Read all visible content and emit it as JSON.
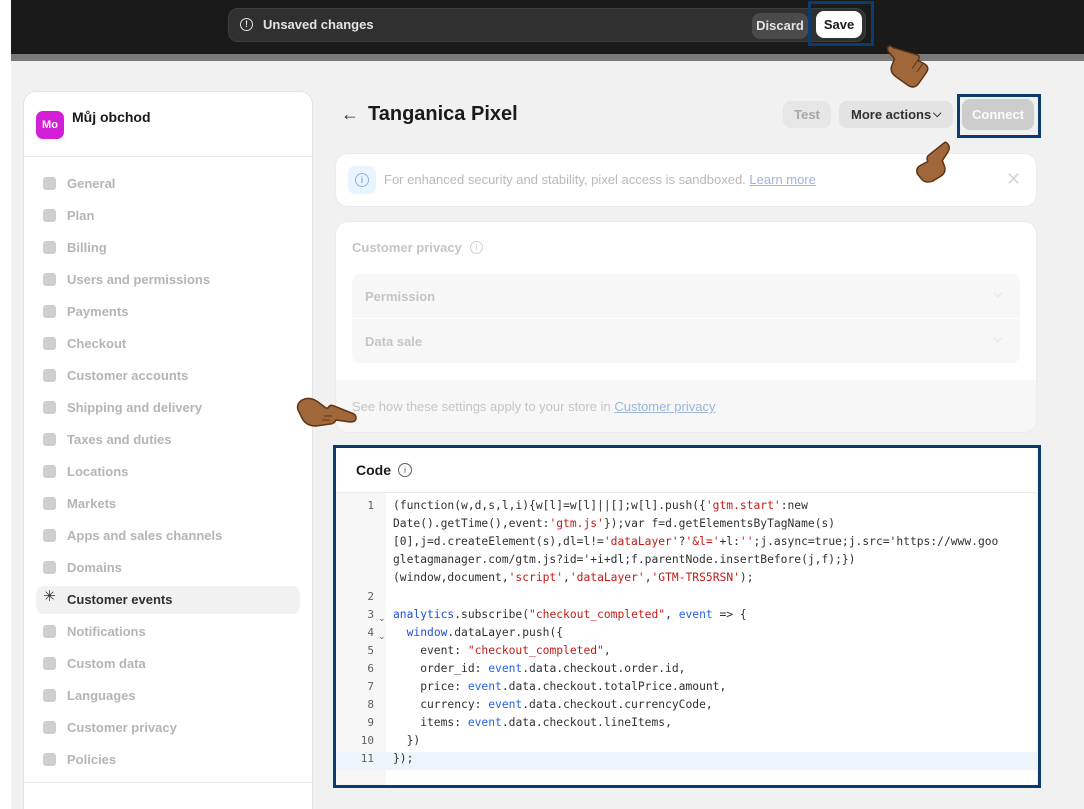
{
  "topbar": {
    "unsaved_label": "Unsaved changes",
    "discard_label": "Discard",
    "save_label": "Save"
  },
  "store": {
    "avatar_initials": "Mo",
    "name": "Můj obchod",
    "avatar_color": "#d31fd7"
  },
  "sidebar": {
    "items": [
      {
        "label": "General",
        "icon": "store-icon"
      },
      {
        "label": "Plan",
        "icon": "chart-icon"
      },
      {
        "label": "Billing",
        "icon": "billing-icon"
      },
      {
        "label": "Users and permissions",
        "icon": "users-icon"
      },
      {
        "label": "Payments",
        "icon": "payment-icon"
      },
      {
        "label": "Checkout",
        "icon": "cart-icon"
      },
      {
        "label": "Customer accounts",
        "icon": "person-icon"
      },
      {
        "label": "Shipping and delivery",
        "icon": "truck-icon"
      },
      {
        "label": "Taxes and duties",
        "icon": "tax-icon"
      },
      {
        "label": "Locations",
        "icon": "location-icon"
      },
      {
        "label": "Markets",
        "icon": "globe-icon"
      },
      {
        "label": "Apps and sales channels",
        "icon": "apps-icon"
      },
      {
        "label": "Domains",
        "icon": "domain-icon"
      },
      {
        "label": "Customer events",
        "icon": "sparkle-icon",
        "active": true
      },
      {
        "label": "Notifications",
        "icon": "bell-icon"
      },
      {
        "label": "Custom data",
        "icon": "database-icon"
      },
      {
        "label": "Languages",
        "icon": "language-icon"
      },
      {
        "label": "Customer privacy",
        "icon": "lock-icon"
      },
      {
        "label": "Policies",
        "icon": "policy-icon"
      }
    ]
  },
  "header": {
    "back_arrow": "←",
    "title": "Tanganica Pixel",
    "test_label": "Test",
    "more_actions_label": "More actions",
    "connect_label": "Connect"
  },
  "banner": {
    "text": "For enhanced security and stability, pixel access is sandboxed.",
    "link": "Learn more",
    "close": "✕"
  },
  "privacy": {
    "title": "Customer privacy",
    "rows": [
      "Permission",
      "Data sale"
    ],
    "footer_text": "See how these settings apply to your store in",
    "footer_link": "Customer privacy"
  },
  "code": {
    "title": "Code",
    "lines": [
      {
        "n": "1",
        "fold": false
      },
      {
        "n": "",
        "fold": false
      },
      {
        "n": "",
        "fold": false
      },
      {
        "n": "",
        "fold": false
      },
      {
        "n": "",
        "fold": false
      },
      {
        "n": "2",
        "fold": false
      },
      {
        "n": "3",
        "fold": true
      },
      {
        "n": "4",
        "fold": true
      },
      {
        "n": "5",
        "fold": false
      },
      {
        "n": "6",
        "fold": false
      },
      {
        "n": "7",
        "fold": false
      },
      {
        "n": "8",
        "fold": false
      },
      {
        "n": "9",
        "fold": false
      },
      {
        "n": "10",
        "fold": false
      },
      {
        "n": "11",
        "fold": false
      }
    ],
    "text": [
      "(function(w,d,s,l,i){w[l]=w[l]||[];w[l].push({'gtm.start':new",
      "Date().getTime(),event:'gtm.js'});var f=d.getElementsByTagName(s)",
      "[0],j=d.createElement(s),dl=l!='dataLayer'?'&l='+l:'';j.async=true;j.src='https://www.goo",
      "gletagmanager.com/gtm.js?id='+i+dl;f.parentNode.insertBefore(j,f);})",
      "(window,document,'script','dataLayer','GTM-TRS5RSN');",
      "",
      "analytics.subscribe(\"checkout_completed\", event => {",
      "  window.dataLayer.push({",
      "    event: \"checkout_completed\",",
      "    order_id: event.data.checkout.order.id,",
      "    price: event.data.checkout.totalPrice.amount,",
      "    currency: event.data.checkout.currencyCode,",
      "    items: event.data.checkout.lineItems,",
      "  })",
      "});"
    ]
  },
  "colors": {
    "topbar": "#1a1a1a",
    "highlight": "#0b3b6f",
    "hand": "#a0683a"
  }
}
